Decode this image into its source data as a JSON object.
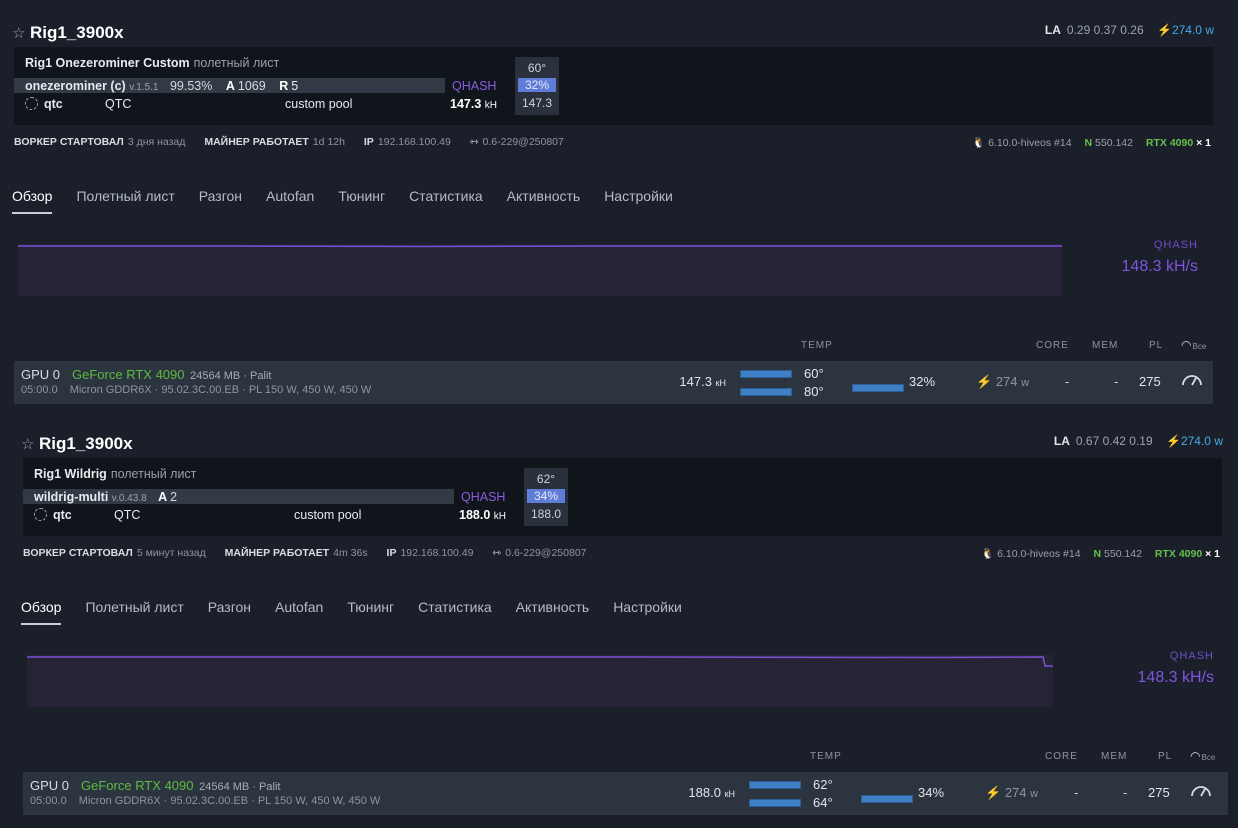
{
  "rigs": [
    {
      "name": "Rig1_3900x",
      "la_label": "LA",
      "la_values": "0.29 0.37 0.26",
      "power": "274.0",
      "power_unit": "w",
      "flight_sheet": "Rig1 Onezerominer Custom",
      "flight_sheet_suffix": "полетный лист",
      "miner": "onezerominer (c)",
      "miner_version": "v.1.5.1",
      "accepted_pct": "99.53%",
      "a_label": "A",
      "a_value": "1069",
      "r_label": "R",
      "r_value": "5",
      "coin": "qtc",
      "coin_ticker": "QTC",
      "pool": "custom pool",
      "algo": "QHASH",
      "hashrate": "147.3",
      "hashrate_unit": "kH",
      "box_temp": "60°",
      "box_fan": "32%",
      "box_rate": "147.3",
      "meta": {
        "started_label": "ВОРКЕР СТАРТОВАЛ",
        "started_value": "3 дня назад",
        "running_label": "МАЙНЕР РАБОТАЕТ",
        "running_value": "1d 12h",
        "ip_label": "IP",
        "ip_value": "192.168.100.49",
        "version": "0.6-229@250807",
        "kernel": "6.10.0-hiveos #14",
        "driver_label": "N",
        "driver_value": "550.142",
        "gpu_model": "RTX 4090",
        "gpu_count": "× 1"
      },
      "tabs": [
        "Обзор",
        "Полетный лист",
        "Разгон",
        "Autofan",
        "Тюнинг",
        "Статистика",
        "Активность",
        "Настройки"
      ],
      "chart_label": "QHASH",
      "chart_value": "148.3 kH/s",
      "headers": {
        "temp": "TEMP",
        "core": "CORE",
        "mem": "MEM",
        "pl": "PL",
        "all": "Все"
      },
      "gpu": {
        "index": "GPU 0",
        "bus": "05:00.0",
        "model": "GeForce RTX 4090",
        "vram": "24564 MB · Palit",
        "details": "Micron GDDR6X · 95.02.3C.00.EB · PL 150 W, 450 W, 450 W",
        "rate": "147.3",
        "rate_unit": "кH",
        "temp_core": "60°",
        "temp_mem": "80°",
        "fan": "32%",
        "power": "274",
        "power_unit": "w",
        "core": "-",
        "mem": "-",
        "pl": "275"
      }
    },
    {
      "name": "Rig1_3900x",
      "la_label": "LA",
      "la_values": "0.67 0.42 0.19",
      "power": "274.0",
      "power_unit": "w",
      "flight_sheet": "Rig1 Wildrig",
      "flight_sheet_suffix": "полетный лист",
      "miner": "wildrig-multi",
      "miner_version": "v.0.43.8",
      "a_label": "A",
      "a_value": "2",
      "coin": "qtc",
      "coin_ticker": "QTC",
      "pool": "custom pool",
      "algo": "QHASH",
      "hashrate": "188.0",
      "hashrate_unit": "kH",
      "box_temp": "62°",
      "box_fan": "34%",
      "box_rate": "188.0",
      "meta": {
        "started_label": "ВОРКЕР СТАРТОВАЛ",
        "started_value": "5 минут назад",
        "running_label": "МАЙНЕР РАБОТАЕТ",
        "running_value": "4m 36s",
        "ip_label": "IP",
        "ip_value": "192.168.100.49",
        "version": "0.6-229@250807",
        "kernel": "6.10.0-hiveos #14",
        "driver_label": "N",
        "driver_value": "550.142",
        "gpu_model": "RTX 4090",
        "gpu_count": "× 1"
      },
      "tabs": [
        "Обзор",
        "Полетный лист",
        "Разгон",
        "Autofan",
        "Тюнинг",
        "Статистика",
        "Активность",
        "Настройки"
      ],
      "chart_label": "QHASH",
      "chart_value": "148.3 kH/s",
      "headers": {
        "temp": "TEMP",
        "core": "CORE",
        "mem": "MEM",
        "pl": "PL",
        "all": "Все"
      },
      "gpu": {
        "index": "GPU 0",
        "bus": "05:00.0",
        "model": "GeForce RTX 4090",
        "vram": "24564 MB · Palit",
        "details": "Micron GDDR6X · 95.02.3C.00.EB · PL 150 W, 450 W, 450 W",
        "rate": "188.0",
        "rate_unit": "кH",
        "temp_core": "62°",
        "temp_mem": "64°",
        "fan": "34%",
        "power": "274",
        "power_unit": "w",
        "core": "-",
        "mem": "-",
        "pl": "275"
      }
    }
  ],
  "colors": {
    "accent_purple": "#7e55e0",
    "gpu_green": "#5dbb3d",
    "power_blue": "#4aa8e8",
    "fan_box": "#5f7cd8"
  },
  "icons": [
    "star-icon",
    "bolt-icon",
    "spinner-icon",
    "linux-icon",
    "version-icon",
    "gauge-icon"
  ]
}
